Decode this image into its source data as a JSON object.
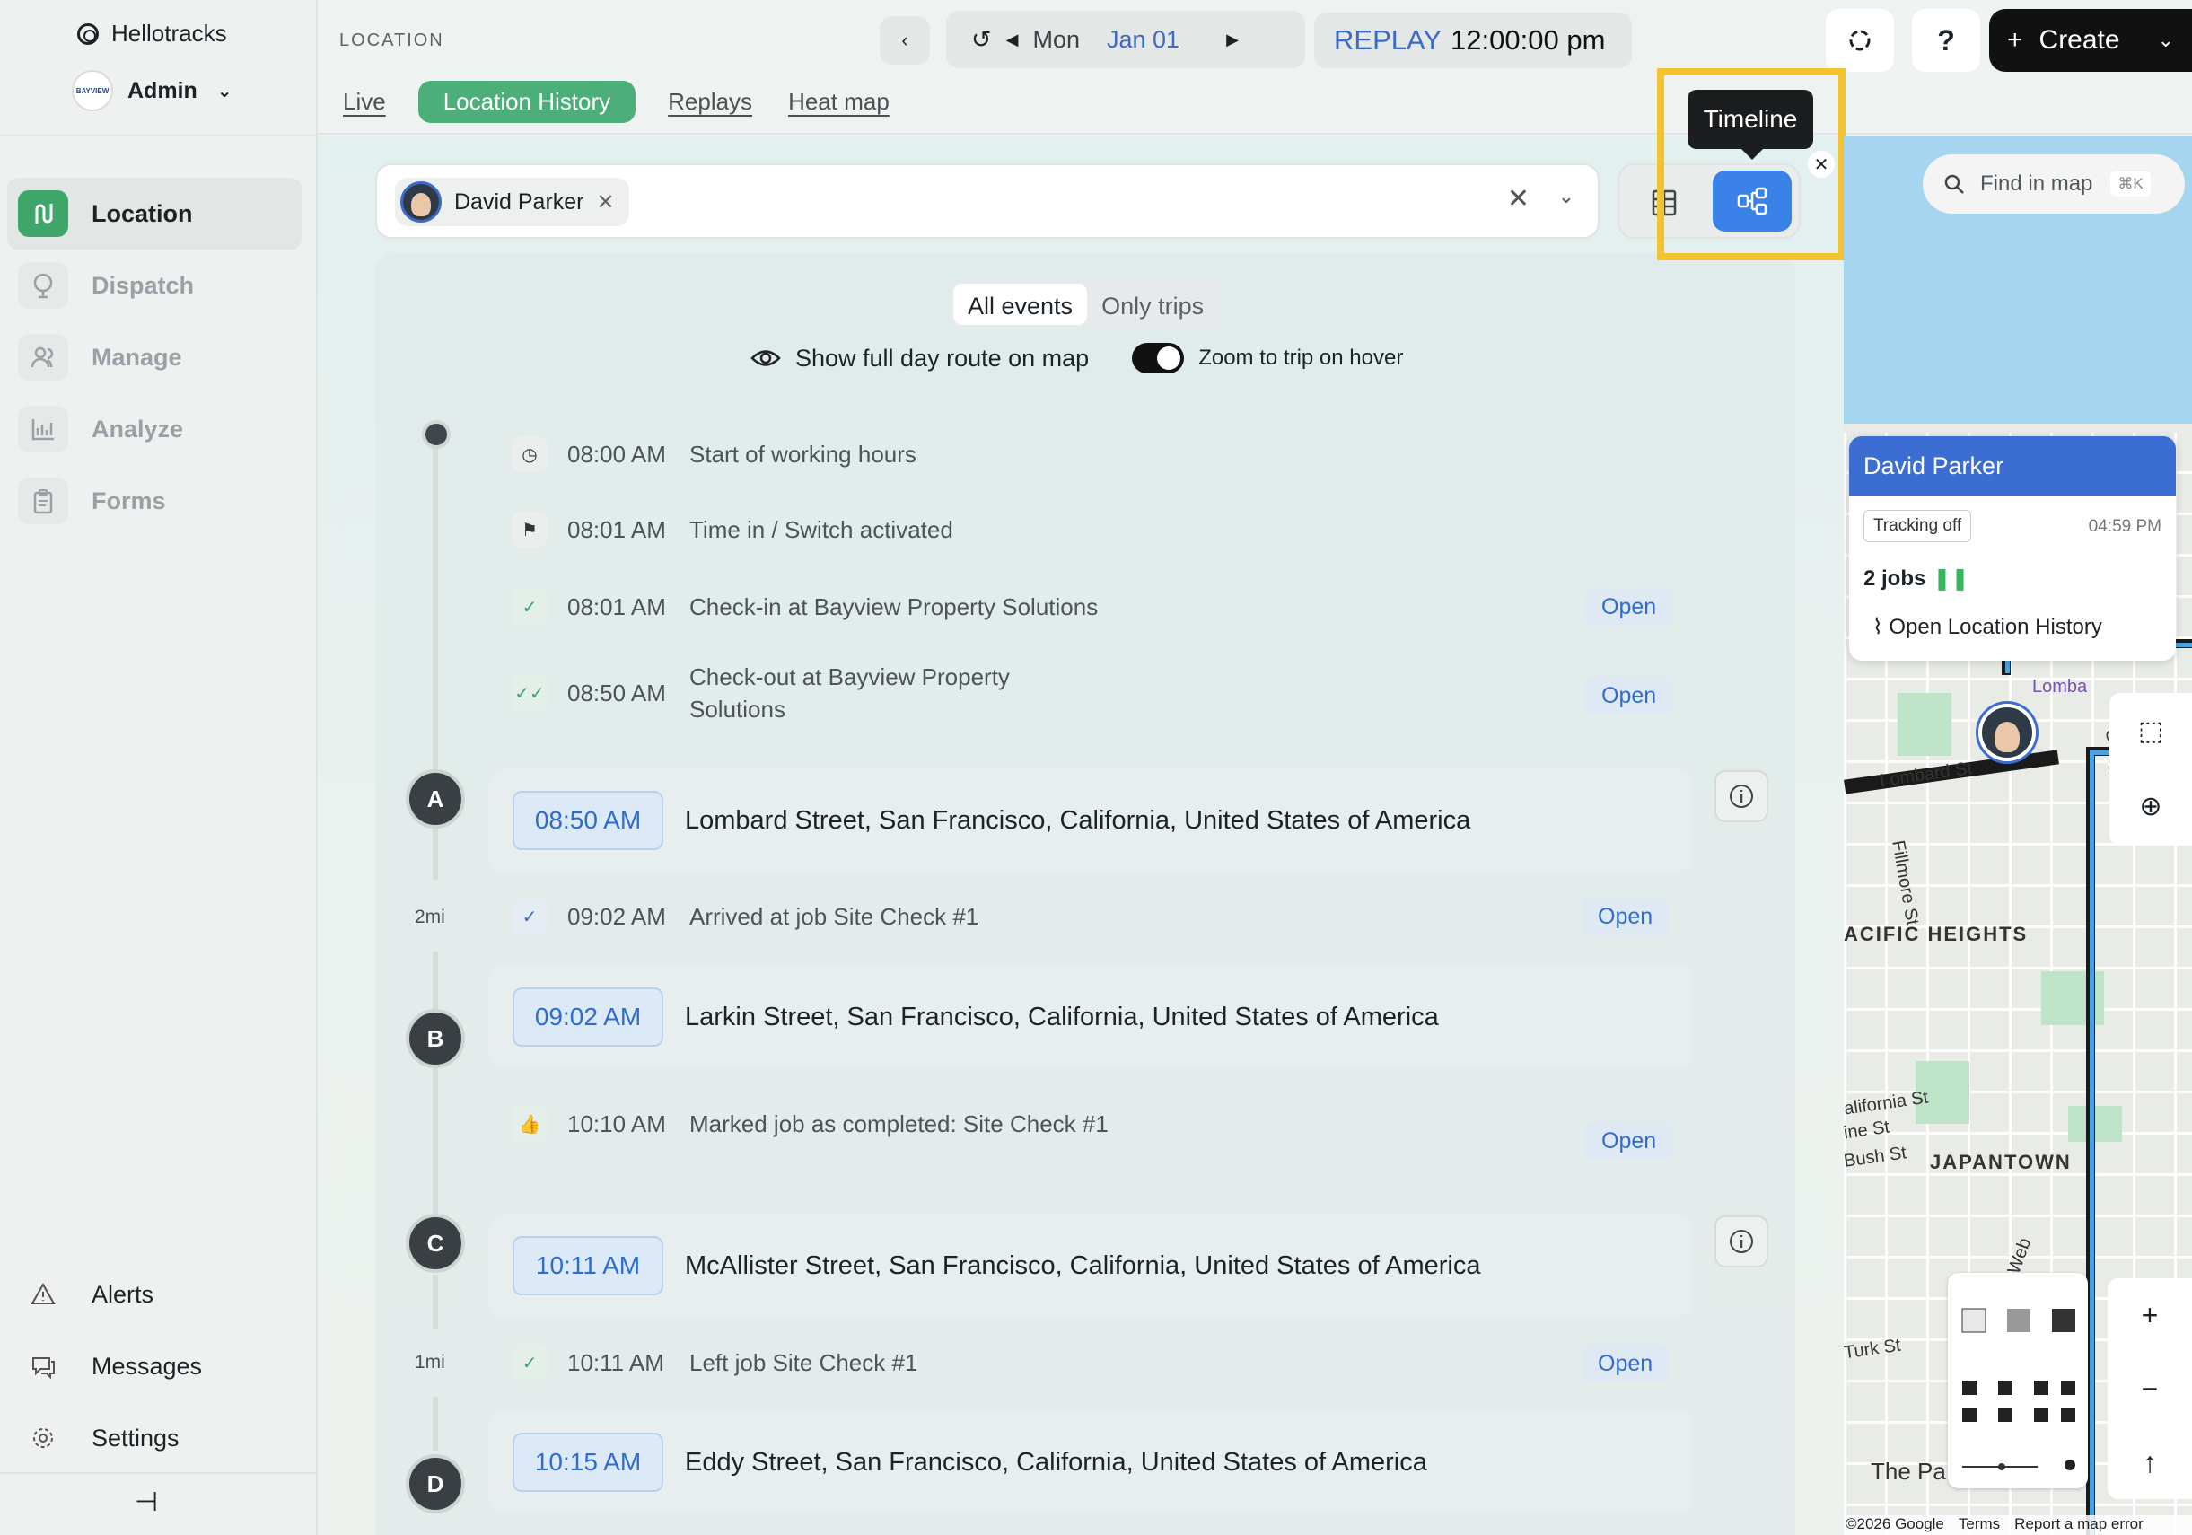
{
  "brand": {
    "name": "Hellotracks"
  },
  "account": {
    "role": "Admin",
    "logo_text": "BAYVIEW"
  },
  "sidebar": {
    "items": [
      {
        "label": "Location",
        "icon": "route-icon",
        "active": true
      },
      {
        "label": "Dispatch",
        "icon": "dispatch-icon"
      },
      {
        "label": "Manage",
        "icon": "users-icon"
      },
      {
        "label": "Analyze",
        "icon": "chart-icon"
      },
      {
        "label": "Forms",
        "icon": "clipboard-icon"
      }
    ],
    "bottom": [
      {
        "label": "Alerts",
        "icon": "alert-icon"
      },
      {
        "label": "Messages",
        "icon": "messages-icon"
      },
      {
        "label": "Settings",
        "icon": "gear-icon"
      }
    ]
  },
  "header": {
    "section": "LOCATION",
    "tabs": [
      "Live",
      "Location History",
      "Replays",
      "Heat map"
    ],
    "active_tab": "Location History",
    "day": "Mon",
    "date": "Jan 01",
    "replay_label": "REPLAY",
    "replay_time": "12:00:00 pm",
    "help": "?",
    "create": "Create"
  },
  "filter": {
    "person": "David Parker"
  },
  "tooltip": "Timeline",
  "view_modes": {
    "segments": [
      "All events",
      "Only trips"
    ],
    "active": "All events"
  },
  "options": {
    "show_route": "Show full day route on map",
    "zoom_toggle": "Zoom to trip on hover",
    "zoom_on": true
  },
  "events": [
    {
      "time": "08:00 AM",
      "text": "Start of working hours",
      "icon": "clock-icon"
    },
    {
      "time": "08:01 AM",
      "text": "Time in / Switch activated",
      "icon": "flag-icon"
    },
    {
      "time": "08:01 AM",
      "text": "Check-in at Bayview Property Solutions",
      "icon": "check-icon",
      "open": "Open"
    },
    {
      "time": "08:50 AM",
      "text": "Check-out at Bayview Property Solutions",
      "icon": "double-check-icon",
      "open": "Open"
    },
    {
      "time": "09:02 AM",
      "text": "Arrived at job Site Check #1",
      "icon": "check-icon",
      "open": "Open"
    },
    {
      "time": "10:10 AM",
      "text": "Marked job as completed: Site Check #1",
      "icon": "thumbs-up-icon",
      "open": "Open"
    },
    {
      "time": "10:11 AM",
      "text": "Left job Site Check #1",
      "icon": "check-icon",
      "open": "Open"
    }
  ],
  "stops": [
    {
      "letter": "A",
      "time": "08:50 AM",
      "address": "Lombard Street, San Francisco, California, United States of America"
    },
    {
      "letter": "B",
      "time": "09:02 AM",
      "address": "Larkin Street, San Francisco, California, United States of America"
    },
    {
      "letter": "C",
      "time": "10:11 AM",
      "address": "McAllister Street, San Francisco, California, United States of America"
    },
    {
      "letter": "D",
      "time": "10:15 AM",
      "address": "Eddy Street, San Francisco, California, United States of America"
    }
  ],
  "distances": [
    "2mi",
    "1mi"
  ],
  "map": {
    "search_placeholder": "Find in map",
    "search_shortcut": "⌘K",
    "popup": {
      "name": "David Parker",
      "status": "Tracking off",
      "time": "04:59 PM",
      "jobs": "2 jobs",
      "link": "Open Location History"
    },
    "labels": [
      "Lombard St",
      "Fillmore St",
      "ACIFIC HEIGHTS",
      "alifornia St",
      "ine St",
      "Bush St",
      "JAPANTOWN",
      "Turk St",
      "The Pa",
      "Gough St",
      "Web",
      "Lomba"
    ],
    "attribution": [
      "©2026 Google",
      "Terms",
      "Report a map error"
    ],
    "zoom": [
      "+",
      "−",
      "↑"
    ]
  }
}
